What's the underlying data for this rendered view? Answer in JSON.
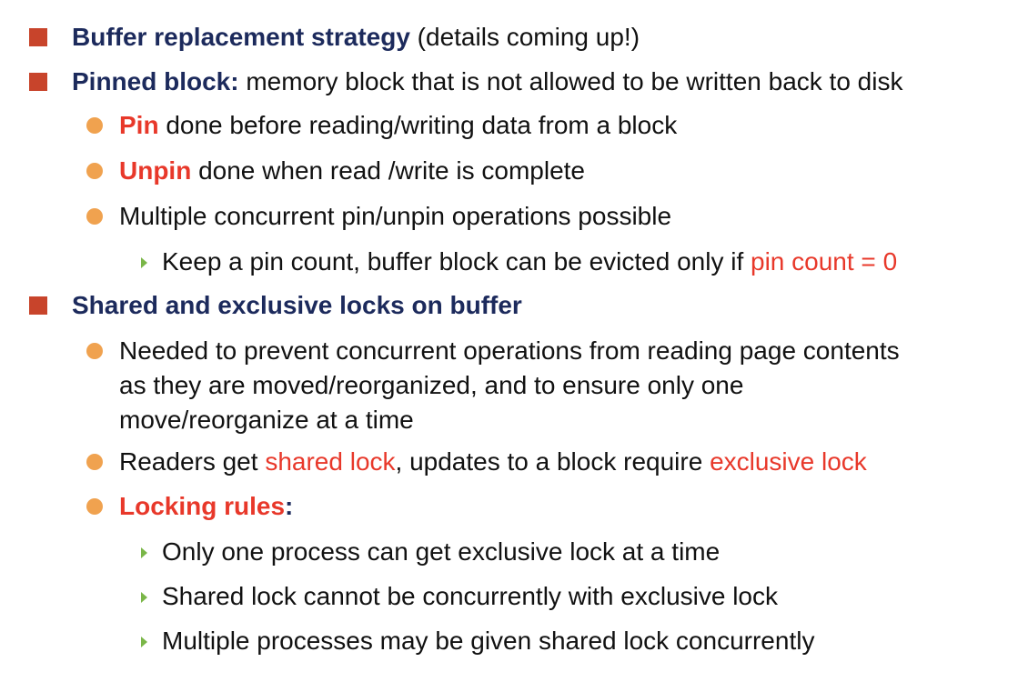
{
  "colors": {
    "square_bullet": "#c8442b",
    "round_bullet": "#f0a24f",
    "triangle_bullet": "#7ab648",
    "heading_navy": "#1c2a5c",
    "highlight_red": "#e8382a"
  },
  "bullets": {
    "b1": {
      "bold": "Buffer replacement strategy",
      "rest": " (details coming up!)"
    },
    "b2": {
      "bold": "Pinned block:",
      "rest": " memory block that is not allowed to be written back to disk",
      "sub1": {
        "bold": "Pin",
        "rest": " done before reading/writing data from a block"
      },
      "sub2": {
        "bold": "Unpin",
        "rest": " done when read /write is complete"
      },
      "sub3": {
        "text": "Multiple concurrent pin/unpin operations possible",
        "sub1": {
          "pre": "Keep a pin count, buffer block can be evicted only if ",
          "red": "pin count = 0"
        }
      }
    },
    "b3": {
      "bold": "Shared and exclusive locks on buffer",
      "sub1": {
        "line1": "Needed to prevent concurrent operations from reading page contents",
        "line2": "as they are moved/reorganized, and to ensure only one",
        "line3": "move/reorganize at a time"
      },
      "sub2": {
        "pre": "Readers get ",
        "red1": "shared lock",
        "mid": ", updates to a block require ",
        "red2": "exclusive lock"
      },
      "sub3": {
        "bold": "Locking rules",
        "colon": ":",
        "items": [
          "Only one process can get exclusive lock at a time",
          "Shared lock cannot be concurrently with exclusive lock",
          "Multiple processes may be given shared lock concurrently"
        ]
      }
    }
  }
}
